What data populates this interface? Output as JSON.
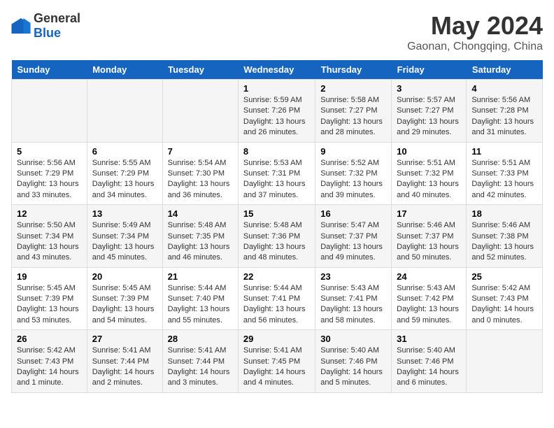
{
  "header": {
    "logo_general": "General",
    "logo_blue": "Blue",
    "month": "May 2024",
    "location": "Gaonan, Chongqing, China"
  },
  "weekdays": [
    "Sunday",
    "Monday",
    "Tuesday",
    "Wednesday",
    "Thursday",
    "Friday",
    "Saturday"
  ],
  "weeks": [
    [
      {
        "day": "",
        "info": ""
      },
      {
        "day": "",
        "info": ""
      },
      {
        "day": "",
        "info": ""
      },
      {
        "day": "1",
        "info": "Sunrise: 5:59 AM\nSunset: 7:26 PM\nDaylight: 13 hours and 26 minutes."
      },
      {
        "day": "2",
        "info": "Sunrise: 5:58 AM\nSunset: 7:27 PM\nDaylight: 13 hours and 28 minutes."
      },
      {
        "day": "3",
        "info": "Sunrise: 5:57 AM\nSunset: 7:27 PM\nDaylight: 13 hours and 29 minutes."
      },
      {
        "day": "4",
        "info": "Sunrise: 5:56 AM\nSunset: 7:28 PM\nDaylight: 13 hours and 31 minutes."
      }
    ],
    [
      {
        "day": "5",
        "info": "Sunrise: 5:56 AM\nSunset: 7:29 PM\nDaylight: 13 hours and 33 minutes."
      },
      {
        "day": "6",
        "info": "Sunrise: 5:55 AM\nSunset: 7:29 PM\nDaylight: 13 hours and 34 minutes."
      },
      {
        "day": "7",
        "info": "Sunrise: 5:54 AM\nSunset: 7:30 PM\nDaylight: 13 hours and 36 minutes."
      },
      {
        "day": "8",
        "info": "Sunrise: 5:53 AM\nSunset: 7:31 PM\nDaylight: 13 hours and 37 minutes."
      },
      {
        "day": "9",
        "info": "Sunrise: 5:52 AM\nSunset: 7:32 PM\nDaylight: 13 hours and 39 minutes."
      },
      {
        "day": "10",
        "info": "Sunrise: 5:51 AM\nSunset: 7:32 PM\nDaylight: 13 hours and 40 minutes."
      },
      {
        "day": "11",
        "info": "Sunrise: 5:51 AM\nSunset: 7:33 PM\nDaylight: 13 hours and 42 minutes."
      }
    ],
    [
      {
        "day": "12",
        "info": "Sunrise: 5:50 AM\nSunset: 7:34 PM\nDaylight: 13 hours and 43 minutes."
      },
      {
        "day": "13",
        "info": "Sunrise: 5:49 AM\nSunset: 7:34 PM\nDaylight: 13 hours and 45 minutes."
      },
      {
        "day": "14",
        "info": "Sunrise: 5:48 AM\nSunset: 7:35 PM\nDaylight: 13 hours and 46 minutes."
      },
      {
        "day": "15",
        "info": "Sunrise: 5:48 AM\nSunset: 7:36 PM\nDaylight: 13 hours and 48 minutes."
      },
      {
        "day": "16",
        "info": "Sunrise: 5:47 AM\nSunset: 7:37 PM\nDaylight: 13 hours and 49 minutes."
      },
      {
        "day": "17",
        "info": "Sunrise: 5:46 AM\nSunset: 7:37 PM\nDaylight: 13 hours and 50 minutes."
      },
      {
        "day": "18",
        "info": "Sunrise: 5:46 AM\nSunset: 7:38 PM\nDaylight: 13 hours and 52 minutes."
      }
    ],
    [
      {
        "day": "19",
        "info": "Sunrise: 5:45 AM\nSunset: 7:39 PM\nDaylight: 13 hours and 53 minutes."
      },
      {
        "day": "20",
        "info": "Sunrise: 5:45 AM\nSunset: 7:39 PM\nDaylight: 13 hours and 54 minutes."
      },
      {
        "day": "21",
        "info": "Sunrise: 5:44 AM\nSunset: 7:40 PM\nDaylight: 13 hours and 55 minutes."
      },
      {
        "day": "22",
        "info": "Sunrise: 5:44 AM\nSunset: 7:41 PM\nDaylight: 13 hours and 56 minutes."
      },
      {
        "day": "23",
        "info": "Sunrise: 5:43 AM\nSunset: 7:41 PM\nDaylight: 13 hours and 58 minutes."
      },
      {
        "day": "24",
        "info": "Sunrise: 5:43 AM\nSunset: 7:42 PM\nDaylight: 13 hours and 59 minutes."
      },
      {
        "day": "25",
        "info": "Sunrise: 5:42 AM\nSunset: 7:43 PM\nDaylight: 14 hours and 0 minutes."
      }
    ],
    [
      {
        "day": "26",
        "info": "Sunrise: 5:42 AM\nSunset: 7:43 PM\nDaylight: 14 hours and 1 minute."
      },
      {
        "day": "27",
        "info": "Sunrise: 5:41 AM\nSunset: 7:44 PM\nDaylight: 14 hours and 2 minutes."
      },
      {
        "day": "28",
        "info": "Sunrise: 5:41 AM\nSunset: 7:44 PM\nDaylight: 14 hours and 3 minutes."
      },
      {
        "day": "29",
        "info": "Sunrise: 5:41 AM\nSunset: 7:45 PM\nDaylight: 14 hours and 4 minutes."
      },
      {
        "day": "30",
        "info": "Sunrise: 5:40 AM\nSunset: 7:46 PM\nDaylight: 14 hours and 5 minutes."
      },
      {
        "day": "31",
        "info": "Sunrise: 5:40 AM\nSunset: 7:46 PM\nDaylight: 14 hours and 6 minutes."
      },
      {
        "day": "",
        "info": ""
      }
    ]
  ]
}
